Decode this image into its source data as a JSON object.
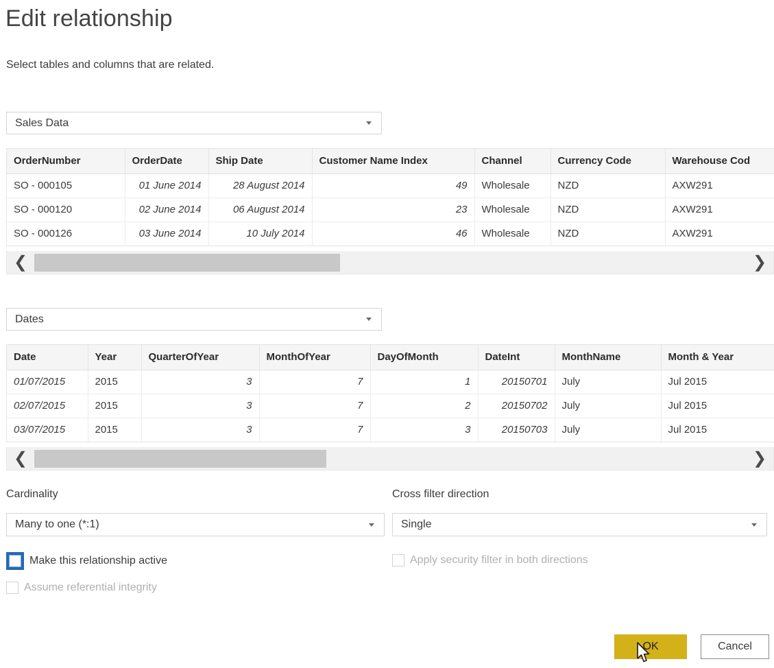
{
  "dialog": {
    "title": "Edit relationship",
    "subtitle": "Select tables and columns that are related."
  },
  "table_picker_1": {
    "value": "Sales Data",
    "icon": "chevron-down-icon"
  },
  "table_picker_2": {
    "value": "Dates",
    "icon": "chevron-down-icon"
  },
  "grid1": {
    "columns": [
      {
        "label": "OrderNumber",
        "align": "left",
        "selected": false
      },
      {
        "label": "OrderDate",
        "align": "right",
        "selected": true
      },
      {
        "label": "Ship Date",
        "align": "right",
        "selected": false
      },
      {
        "label": "Customer Name Index",
        "align": "right",
        "selected": false
      },
      {
        "label": "Channel",
        "align": "left",
        "selected": false
      },
      {
        "label": "Currency Code",
        "align": "left",
        "selected": false
      },
      {
        "label": "Warehouse Cod",
        "align": "left",
        "selected": false
      }
    ],
    "rows": [
      [
        "SO - 000105",
        "01 June 2014",
        "28 August 2014",
        "49",
        "Wholesale",
        "NZD",
        "AXW291"
      ],
      [
        "SO - 000120",
        "02 June 2014",
        "06 August 2014",
        "23",
        "Wholesale",
        "NZD",
        "AXW291"
      ],
      [
        "SO - 000126",
        "03 June 2014",
        "10 July 2014",
        "46",
        "Wholesale",
        "NZD",
        "AXW291"
      ]
    ]
  },
  "grid2": {
    "columns": [
      {
        "label": "Date",
        "align": "center",
        "selected": true
      },
      {
        "label": "Year",
        "align": "left",
        "selected": false
      },
      {
        "label": "QuarterOfYear",
        "align": "right",
        "selected": false
      },
      {
        "label": "MonthOfYear",
        "align": "right",
        "selected": false
      },
      {
        "label": "DayOfMonth",
        "align": "right",
        "selected": false
      },
      {
        "label": "DateInt",
        "align": "right",
        "selected": false
      },
      {
        "label": "MonthName",
        "align": "left",
        "selected": false
      },
      {
        "label": "Month & Year",
        "align": "left",
        "selected": false
      }
    ],
    "rows": [
      [
        "01/07/2015",
        "2015",
        "3",
        "7",
        "1",
        "20150701",
        "July",
        "Jul 2015"
      ],
      [
        "02/07/2015",
        "2015",
        "3",
        "7",
        "2",
        "20150702",
        "July",
        "Jul 2015"
      ],
      [
        "03/07/2015",
        "2015",
        "3",
        "7",
        "3",
        "20150703",
        "July",
        "Jul 2015"
      ]
    ]
  },
  "scrollbars": {
    "left_arrow": "❮",
    "right_arrow": "❯"
  },
  "options": {
    "cardinality_label": "Cardinality",
    "cardinality_value": "Many to one (*:1)",
    "cross_filter_label": "Cross filter direction",
    "cross_filter_value": "Single",
    "make_active_label": "Make this relationship active",
    "apply_security_label": "Apply security filter in both directions",
    "assume_ref_integrity_label": "Assume referential integrity"
  },
  "footer": {
    "ok_label": "OK",
    "cancel_label": "Cancel"
  },
  "colors": {
    "accent_ok": "#d3b219",
    "focus_ring": "#1d6bbd",
    "selected_column": "#f1f1f1",
    "header_bg": "#f5f5f5"
  }
}
